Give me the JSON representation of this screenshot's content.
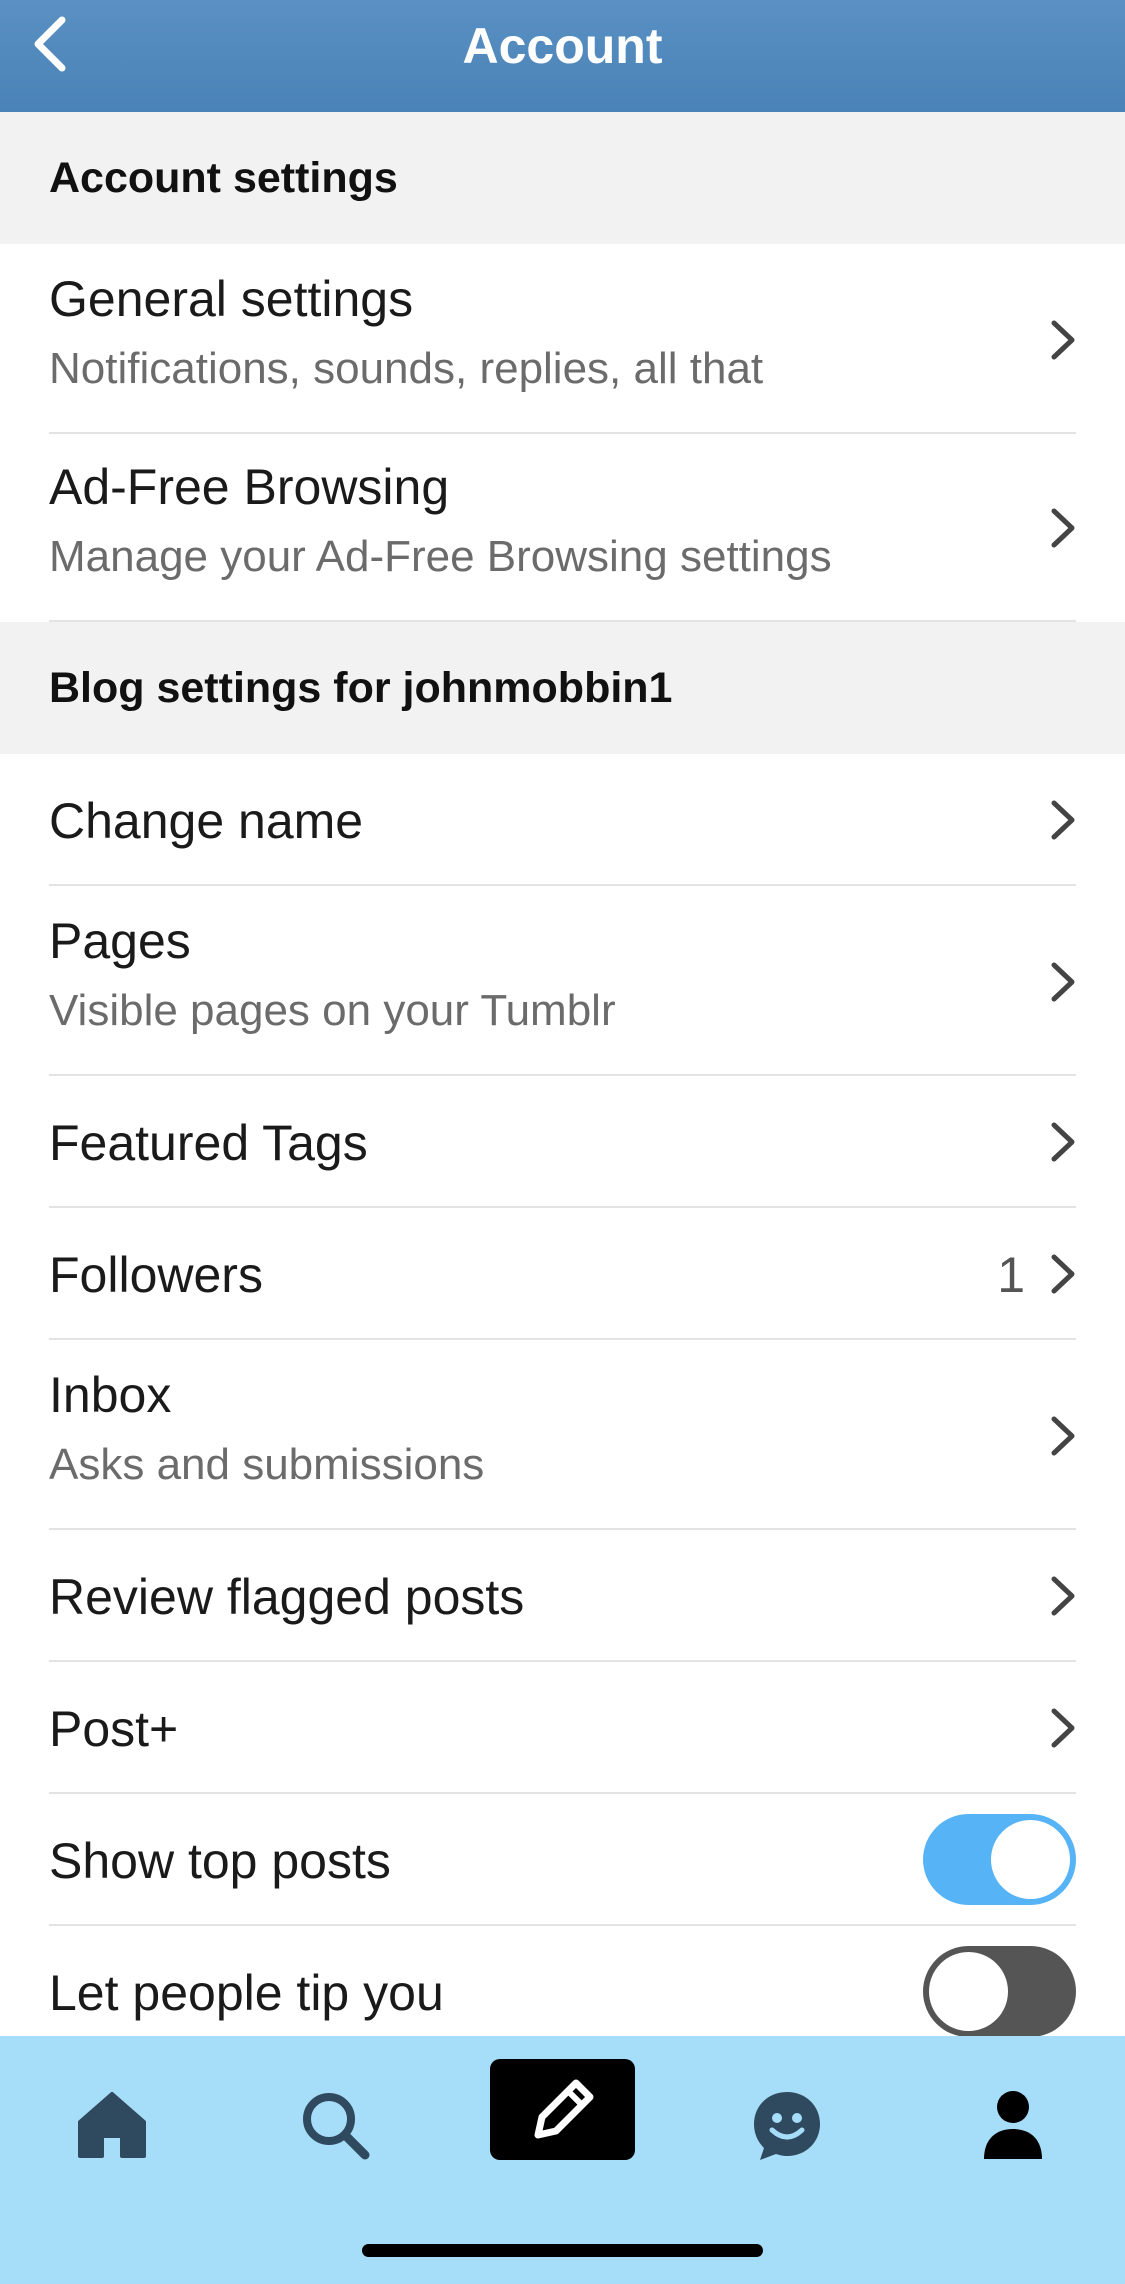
{
  "header": {
    "title": "Account"
  },
  "sections": {
    "account": {
      "title": "Account settings"
    },
    "blog": {
      "title": "Blog settings for johnmobbin1"
    }
  },
  "rows": {
    "general": {
      "label": "General settings",
      "sub": "Notifications, sounds, replies, all that"
    },
    "adfree": {
      "label": "Ad-Free Browsing",
      "sub": "Manage your Ad-Free Browsing settings"
    },
    "change_name": {
      "label": "Change name"
    },
    "pages": {
      "label": "Pages",
      "sub": "Visible pages on your Tumblr"
    },
    "featured_tags": {
      "label": "Featured Tags"
    },
    "followers": {
      "label": "Followers",
      "count": "1"
    },
    "inbox": {
      "label": "Inbox",
      "sub": "Asks and submissions"
    },
    "review_flagged": {
      "label": "Review flagged posts"
    },
    "post_plus": {
      "label": "Post+"
    },
    "show_top_posts": {
      "label": "Show top posts",
      "enabled": true
    },
    "tip": {
      "label": "Let people tip you",
      "enabled": false
    }
  },
  "icons": {
    "back": "chevron-left-icon",
    "row_arrow": "chevron-right-icon",
    "tabs": [
      "home-icon",
      "search-icon",
      "pencil-icon",
      "smiley-chat-icon",
      "person-icon"
    ]
  },
  "colors": {
    "header": "#4a83b8",
    "toggle_on": "#56b4f6",
    "toggle_off": "#555555",
    "tabbar": "#a6ddf8",
    "section_bg": "#f2f2f2"
  }
}
